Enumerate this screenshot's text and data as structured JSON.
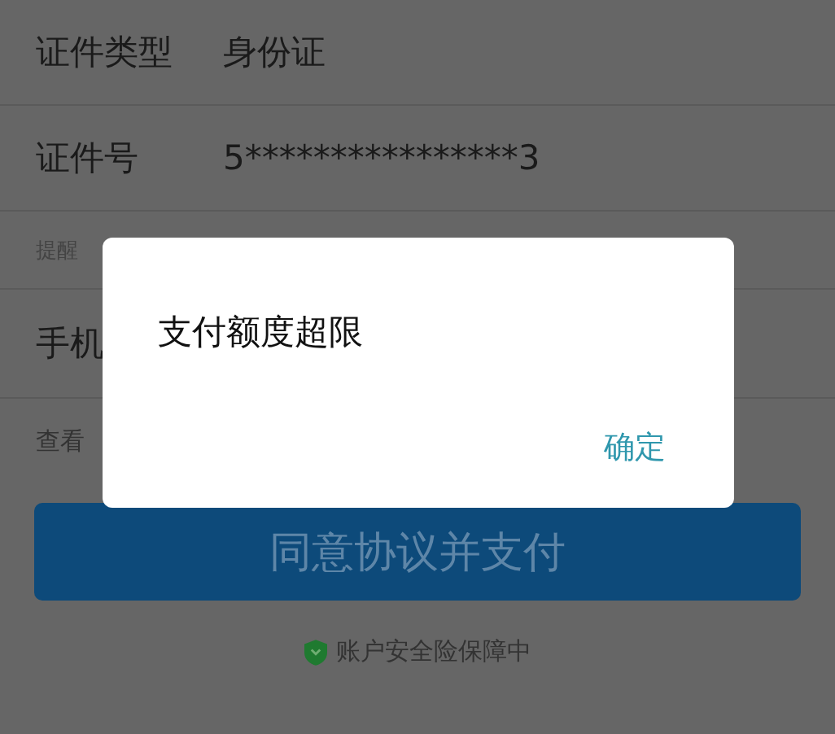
{
  "form": {
    "rows": [
      {
        "label": "证件类型",
        "value": "身份证"
      },
      {
        "label": "证件号",
        "value": "5****************3"
      }
    ],
    "tip": "提醒",
    "phone_label": "手机",
    "view_link": "查看"
  },
  "pay_button": {
    "label": "同意协议并支付"
  },
  "security_note": "账户安全险保障中",
  "dialog": {
    "message": "支付额度超限",
    "buttons": [
      "确定"
    ]
  }
}
